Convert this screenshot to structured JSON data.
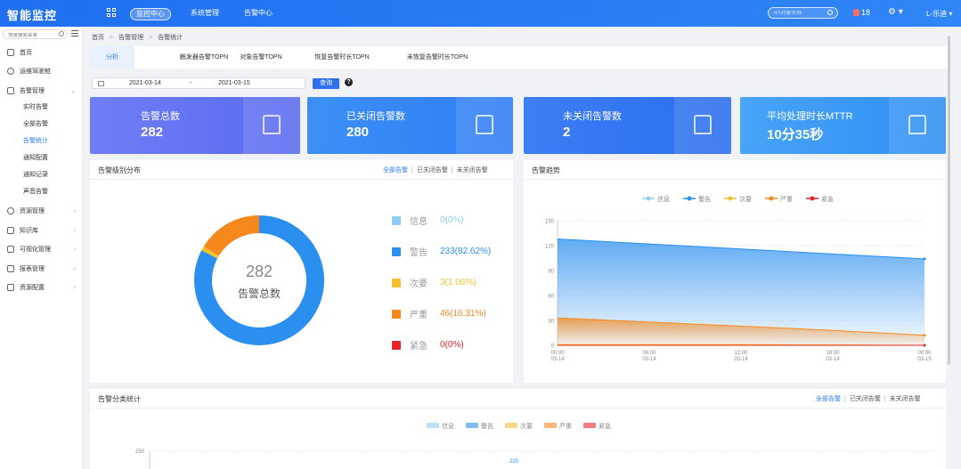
{
  "app": {
    "title": "智能监控"
  },
  "topnav": [
    "监控中心",
    "系统管理",
    "告警中心"
  ],
  "top_search": {
    "placeholder": "IP/对象名称"
  },
  "alerts_count": "18",
  "user": "L-乐迪",
  "sidebar": {
    "search_placeholder": "快速搜索菜单",
    "items": [
      "首页",
      "运维驾驶舱",
      "告警管理",
      "资源管理",
      "知识库",
      "可视化管理",
      "报表管理",
      "资源配置"
    ],
    "sub_items": [
      "实时告警",
      "全部告警",
      "告警统计",
      "通知配置",
      "通知记录",
      "声音告警"
    ]
  },
  "breadcrumb": [
    "首页",
    "告警管理",
    "告警统计"
  ],
  "tabs": [
    "分析",
    "触发器告警TOPN",
    "对象告警TOPN",
    "恢复告警时长TOPN",
    "未恢复告警时长TOPN"
  ],
  "date_range": {
    "start": "2021-03-14",
    "sep": "-",
    "end": "2021-03-15"
  },
  "query_label": "查询",
  "cards": [
    {
      "title": "告警总数",
      "value": "282"
    },
    {
      "title": "已关闭告警数",
      "value": "280"
    },
    {
      "title": "未关闭告警数",
      "value": "2"
    },
    {
      "title": "平均处理时长MTTR",
      "value": "10分35秒"
    }
  ],
  "level_panel": {
    "title": "告警级别分布",
    "filters": [
      "全部告警",
      "已关闭告警",
      "未关闭告警"
    ],
    "center_value": "282",
    "center_label": "告警总数"
  },
  "trend_panel": {
    "title": "告警趋势"
  },
  "category_panel": {
    "title": "告警分类统计",
    "filters": [
      "全部告警",
      "已关闭告警",
      "未关闭告警"
    ]
  },
  "colors": {
    "info": "#8fcdf4",
    "warning": "#2b8ff0",
    "minor": "#f2c22e",
    "major": "#f5891e",
    "critical": "#e8262a"
  },
  "chart_data": [
    {
      "type": "pie",
      "title": "告警级别分布",
      "labels": [
        "信息",
        "警告",
        "次要",
        "严重",
        "紧急"
      ],
      "values": [
        0,
        233,
        3,
        46,
        0
      ],
      "display": [
        "0(0%)",
        "233(82.62%)",
        "3(1.06%)",
        "46(16.31%)",
        "0(0%)"
      ]
    },
    {
      "type": "area",
      "title": "告警趋势",
      "x": [
        "00:00\n03-14",
        "06:00\n03-14",
        "12:00\n03-14",
        "18:00\n03-14",
        "00:00\n03-15"
      ],
      "legend": [
        "信息",
        "警告",
        "次要",
        "严重",
        "紧急"
      ],
      "ylim": [
        0,
        150
      ],
      "yticks": [
        0,
        30,
        60,
        90,
        120,
        150
      ],
      "series": [
        {
          "name": "信息",
          "values": [
            0,
            0,
            0,
            0,
            0
          ]
        },
        {
          "name": "警告",
          "values": [
            128,
            122,
            116,
            110,
            104
          ]
        },
        {
          "name": "次要",
          "values": [
            1,
            1,
            1,
            0.5,
            0
          ]
        },
        {
          "name": "严重",
          "values": [
            33,
            28,
            23,
            18,
            12
          ]
        },
        {
          "name": "紧急",
          "values": [
            0,
            0,
            0,
            0,
            0
          ]
        }
      ]
    },
    {
      "type": "bar",
      "title": "告警分类统计",
      "legend": [
        "信息",
        "警告",
        "次要",
        "严重",
        "紧急"
      ],
      "yticks": [
        250
      ],
      "data_labels": [
        "220"
      ]
    }
  ]
}
